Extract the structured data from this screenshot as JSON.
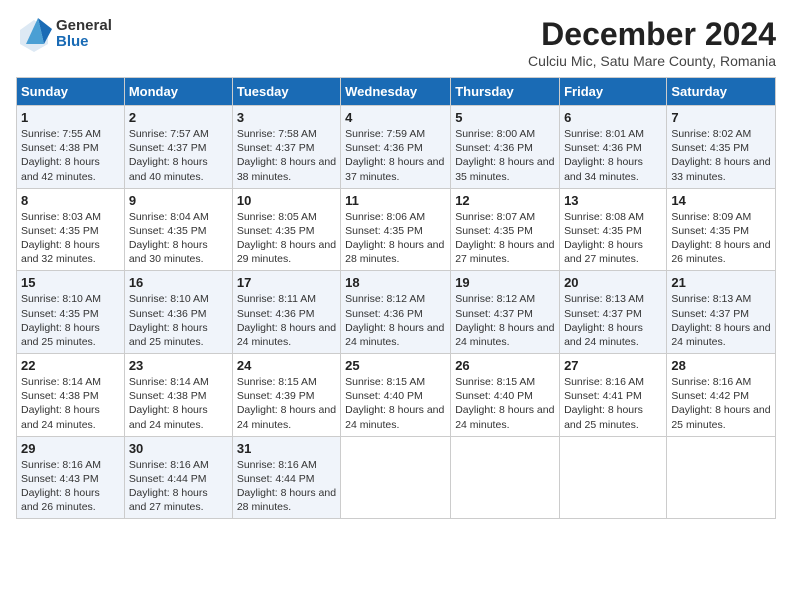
{
  "logo": {
    "general": "General",
    "blue": "Blue"
  },
  "header": {
    "month": "December 2024",
    "location": "Culciu Mic, Satu Mare County, Romania"
  },
  "weekdays": [
    "Sunday",
    "Monday",
    "Tuesday",
    "Wednesday",
    "Thursday",
    "Friday",
    "Saturday"
  ],
  "weeks": [
    [
      {
        "day": "1",
        "sunrise": "Sunrise: 7:55 AM",
        "sunset": "Sunset: 4:38 PM",
        "daylight": "Daylight: 8 hours and 42 minutes."
      },
      {
        "day": "2",
        "sunrise": "Sunrise: 7:57 AM",
        "sunset": "Sunset: 4:37 PM",
        "daylight": "Daylight: 8 hours and 40 minutes."
      },
      {
        "day": "3",
        "sunrise": "Sunrise: 7:58 AM",
        "sunset": "Sunset: 4:37 PM",
        "daylight": "Daylight: 8 hours and 38 minutes."
      },
      {
        "day": "4",
        "sunrise": "Sunrise: 7:59 AM",
        "sunset": "Sunset: 4:36 PM",
        "daylight": "Daylight: 8 hours and 37 minutes."
      },
      {
        "day": "5",
        "sunrise": "Sunrise: 8:00 AM",
        "sunset": "Sunset: 4:36 PM",
        "daylight": "Daylight: 8 hours and 35 minutes."
      },
      {
        "day": "6",
        "sunrise": "Sunrise: 8:01 AM",
        "sunset": "Sunset: 4:36 PM",
        "daylight": "Daylight: 8 hours and 34 minutes."
      },
      {
        "day": "7",
        "sunrise": "Sunrise: 8:02 AM",
        "sunset": "Sunset: 4:35 PM",
        "daylight": "Daylight: 8 hours and 33 minutes."
      }
    ],
    [
      {
        "day": "8",
        "sunrise": "Sunrise: 8:03 AM",
        "sunset": "Sunset: 4:35 PM",
        "daylight": "Daylight: 8 hours and 32 minutes."
      },
      {
        "day": "9",
        "sunrise": "Sunrise: 8:04 AM",
        "sunset": "Sunset: 4:35 PM",
        "daylight": "Daylight: 8 hours and 30 minutes."
      },
      {
        "day": "10",
        "sunrise": "Sunrise: 8:05 AM",
        "sunset": "Sunset: 4:35 PM",
        "daylight": "Daylight: 8 hours and 29 minutes."
      },
      {
        "day": "11",
        "sunrise": "Sunrise: 8:06 AM",
        "sunset": "Sunset: 4:35 PM",
        "daylight": "Daylight: 8 hours and 28 minutes."
      },
      {
        "day": "12",
        "sunrise": "Sunrise: 8:07 AM",
        "sunset": "Sunset: 4:35 PM",
        "daylight": "Daylight: 8 hours and 27 minutes."
      },
      {
        "day": "13",
        "sunrise": "Sunrise: 8:08 AM",
        "sunset": "Sunset: 4:35 PM",
        "daylight": "Daylight: 8 hours and 27 minutes."
      },
      {
        "day": "14",
        "sunrise": "Sunrise: 8:09 AM",
        "sunset": "Sunset: 4:35 PM",
        "daylight": "Daylight: 8 hours and 26 minutes."
      }
    ],
    [
      {
        "day": "15",
        "sunrise": "Sunrise: 8:10 AM",
        "sunset": "Sunset: 4:35 PM",
        "daylight": "Daylight: 8 hours and 25 minutes."
      },
      {
        "day": "16",
        "sunrise": "Sunrise: 8:10 AM",
        "sunset": "Sunset: 4:36 PM",
        "daylight": "Daylight: 8 hours and 25 minutes."
      },
      {
        "day": "17",
        "sunrise": "Sunrise: 8:11 AM",
        "sunset": "Sunset: 4:36 PM",
        "daylight": "Daylight: 8 hours and 24 minutes."
      },
      {
        "day": "18",
        "sunrise": "Sunrise: 8:12 AM",
        "sunset": "Sunset: 4:36 PM",
        "daylight": "Daylight: 8 hours and 24 minutes."
      },
      {
        "day": "19",
        "sunrise": "Sunrise: 8:12 AM",
        "sunset": "Sunset: 4:37 PM",
        "daylight": "Daylight: 8 hours and 24 minutes."
      },
      {
        "day": "20",
        "sunrise": "Sunrise: 8:13 AM",
        "sunset": "Sunset: 4:37 PM",
        "daylight": "Daylight: 8 hours and 24 minutes."
      },
      {
        "day": "21",
        "sunrise": "Sunrise: 8:13 AM",
        "sunset": "Sunset: 4:37 PM",
        "daylight": "Daylight: 8 hours and 24 minutes."
      }
    ],
    [
      {
        "day": "22",
        "sunrise": "Sunrise: 8:14 AM",
        "sunset": "Sunset: 4:38 PM",
        "daylight": "Daylight: 8 hours and 24 minutes."
      },
      {
        "day": "23",
        "sunrise": "Sunrise: 8:14 AM",
        "sunset": "Sunset: 4:38 PM",
        "daylight": "Daylight: 8 hours and 24 minutes."
      },
      {
        "day": "24",
        "sunrise": "Sunrise: 8:15 AM",
        "sunset": "Sunset: 4:39 PM",
        "daylight": "Daylight: 8 hours and 24 minutes."
      },
      {
        "day": "25",
        "sunrise": "Sunrise: 8:15 AM",
        "sunset": "Sunset: 4:40 PM",
        "daylight": "Daylight: 8 hours and 24 minutes."
      },
      {
        "day": "26",
        "sunrise": "Sunrise: 8:15 AM",
        "sunset": "Sunset: 4:40 PM",
        "daylight": "Daylight: 8 hours and 24 minutes."
      },
      {
        "day": "27",
        "sunrise": "Sunrise: 8:16 AM",
        "sunset": "Sunset: 4:41 PM",
        "daylight": "Daylight: 8 hours and 25 minutes."
      },
      {
        "day": "28",
        "sunrise": "Sunrise: 8:16 AM",
        "sunset": "Sunset: 4:42 PM",
        "daylight": "Daylight: 8 hours and 25 minutes."
      }
    ],
    [
      {
        "day": "29",
        "sunrise": "Sunrise: 8:16 AM",
        "sunset": "Sunset: 4:43 PM",
        "daylight": "Daylight: 8 hours and 26 minutes."
      },
      {
        "day": "30",
        "sunrise": "Sunrise: 8:16 AM",
        "sunset": "Sunset: 4:44 PM",
        "daylight": "Daylight: 8 hours and 27 minutes."
      },
      {
        "day": "31",
        "sunrise": "Sunrise: 8:16 AM",
        "sunset": "Sunset: 4:44 PM",
        "daylight": "Daylight: 8 hours and 28 minutes."
      },
      null,
      null,
      null,
      null
    ]
  ]
}
